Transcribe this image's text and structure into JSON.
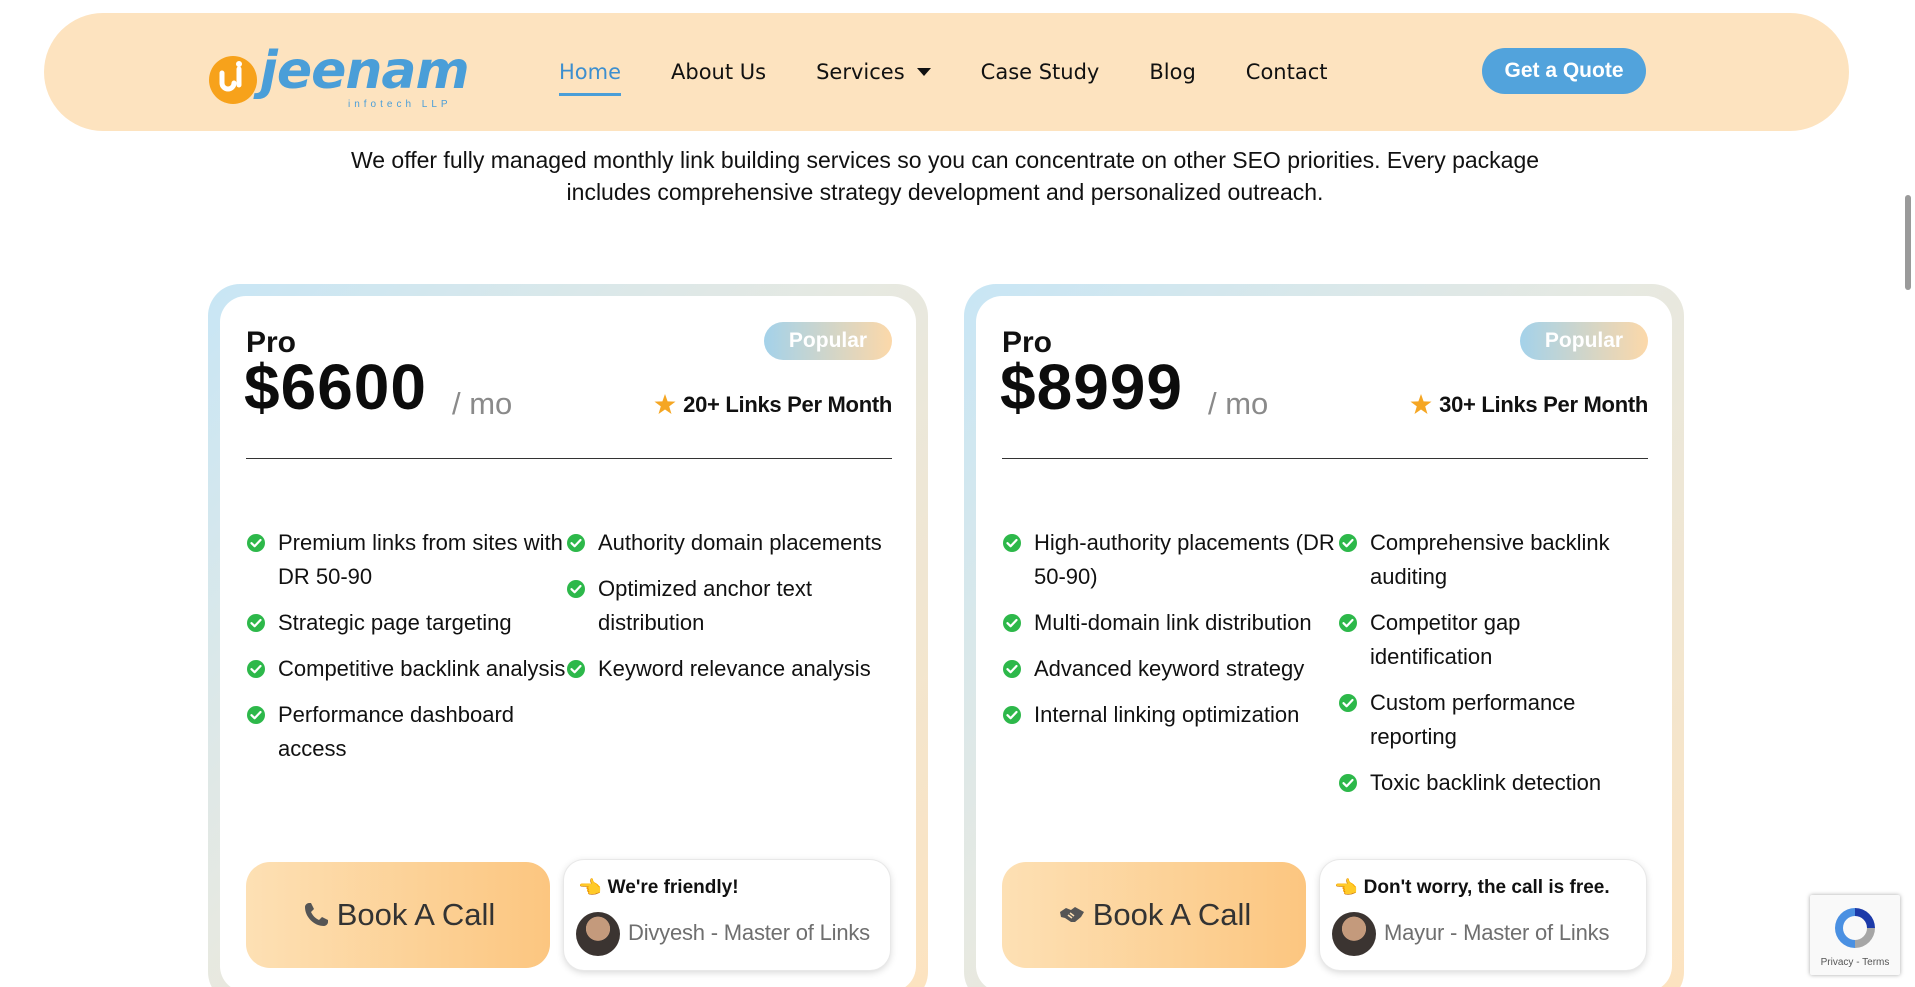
{
  "header": {
    "logo_word": "jeenam",
    "logo_sub": "infotech LLP",
    "nav": [
      {
        "label": "Home",
        "active": true
      },
      {
        "label": "About Us"
      },
      {
        "label": "Services",
        "has_dropdown": true
      },
      {
        "label": "Case Study"
      },
      {
        "label": "Blog"
      },
      {
        "label": "Contact"
      }
    ],
    "cta_label": "Get a Quote"
  },
  "intro_text": "We offer fully managed monthly link building services so you can concentrate on other SEO priorities. Every package includes comprehensive strategy development and personalized outreach.",
  "plans": [
    {
      "name": "Pro",
      "price": "$6600",
      "period": "/ mo",
      "badge": "Popular",
      "links_per_month": "20+ Links Per Month",
      "features_left": [
        "Premium links from sites with DR 50-90",
        "Strategic page targeting",
        "Competitive backlink analysis",
        "Performance dashboard access"
      ],
      "features_right": [
        "Authority domain placements",
        "Optimized anchor text distribution",
        "Keyword relevance analysis"
      ],
      "book_label": "Book A Call",
      "book_icon": "phone-icon",
      "note": "We're friendly!",
      "person": "Divyesh - Master of Links"
    },
    {
      "name": "Pro",
      "price": "$8999",
      "period": "/ mo",
      "badge": "Popular",
      "links_per_month": "30+ Links Per Month",
      "features_left": [
        "High-authority placements (DR 50-90)",
        "Multi-domain link distribution",
        "Advanced keyword strategy",
        "Internal linking optimization"
      ],
      "features_right": [
        "Comprehensive backlink auditing",
        "Competitor gap identification",
        "Custom performance reporting",
        "Toxic backlink detection"
      ],
      "book_label": "Book A Call",
      "book_icon": "handshake-icon",
      "note": "Don't worry, the call is free.",
      "person": "Mayur - Master of Links"
    }
  ],
  "recaptcha": {
    "text": "Privacy - Terms"
  },
  "colors": {
    "header_bg": "#fde3bf",
    "accent_blue": "#4a9ed8",
    "check_green": "#2db84a",
    "star_orange": "#f5a623"
  }
}
